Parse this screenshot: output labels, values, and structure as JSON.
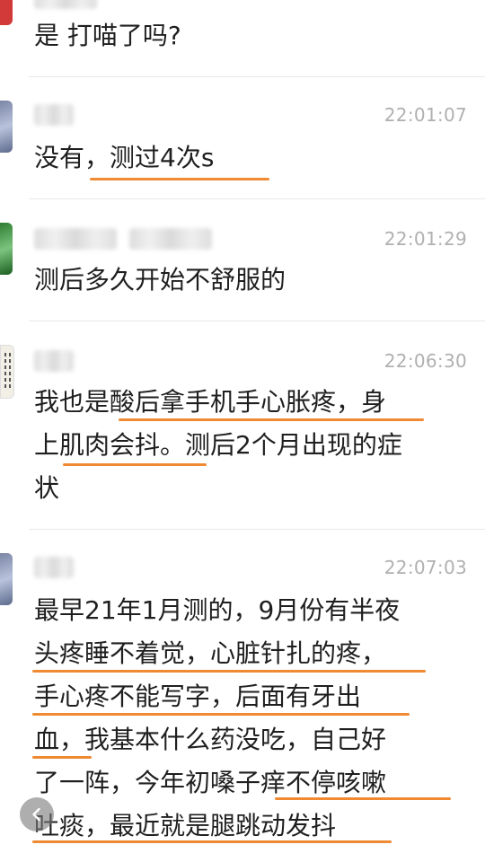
{
  "messages": [
    {
      "text_lines": [
        "是 打喵了吗?"
      ]
    },
    {
      "time": "22:01:07",
      "text_lines": [
        "没有，测过4次s"
      ]
    },
    {
      "time": "22:01:29",
      "text_lines": [
        "测后多久开始不舒服的"
      ]
    },
    {
      "time": "22:06:30",
      "text_lines": [
        "我也是酸后拿手机手心胀疼，身",
        "上肌肉会抖。测后2个月出现的症",
        "状"
      ]
    },
    {
      "time": "22:07:03",
      "text_lines": [
        "最早21年1月测的，9月份有半夜",
        "头疼睡不着觉，心脏针扎的疼，",
        "手心疼不能写字，后面有牙出",
        "血，我基本什么药没吃，自己好",
        "了一阵，今年初嗓子痒不停咳嗽",
        "吐痰，最近就是腿跳动发抖"
      ]
    }
  ],
  "colors": {
    "underline": "#f08a32",
    "time": "#b0b0b0",
    "divider": "#e8e8e8"
  },
  "icons": {
    "back": "chevron-left-icon"
  }
}
